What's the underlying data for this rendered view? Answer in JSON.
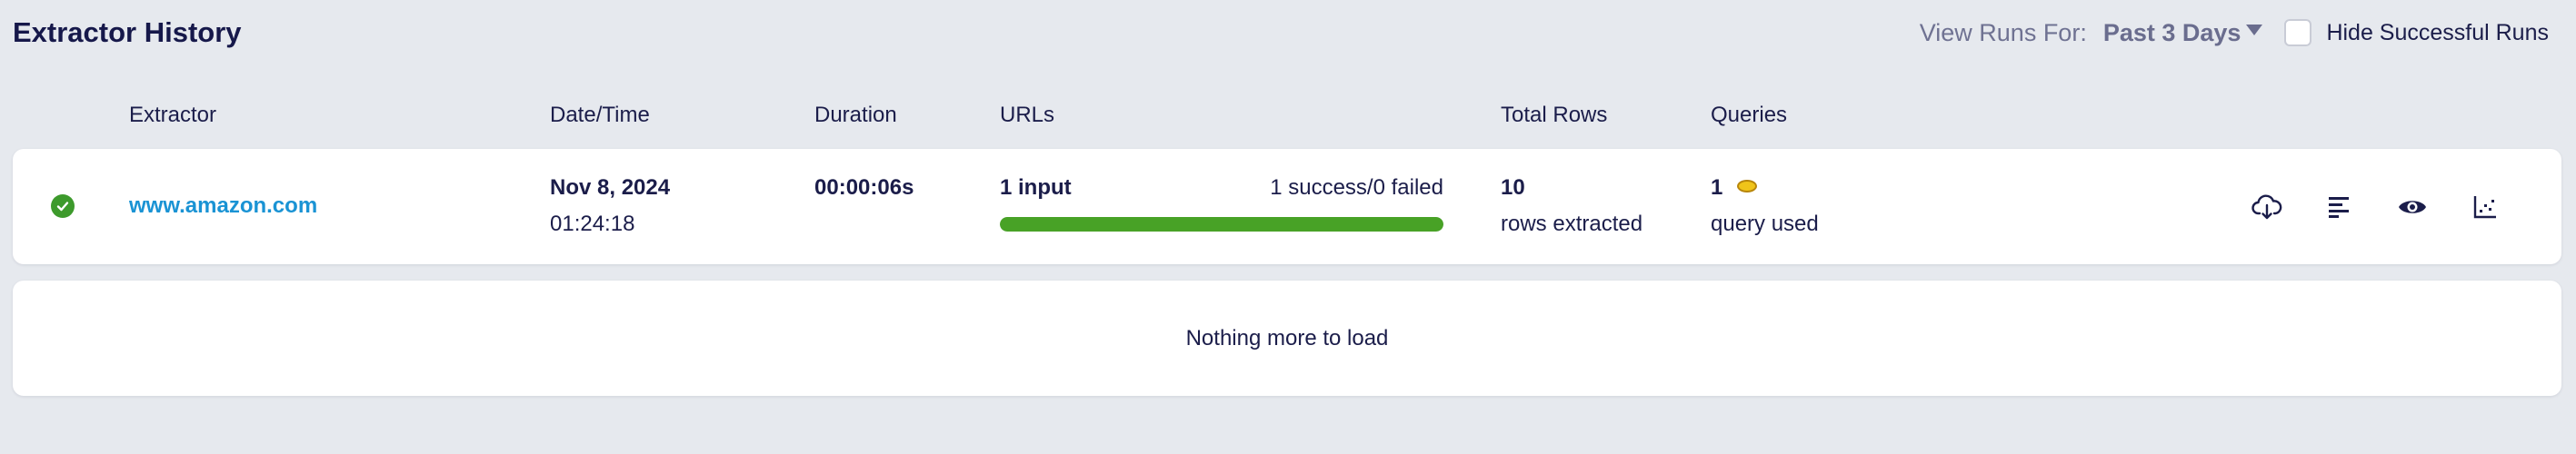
{
  "header": {
    "title": "Extractor History",
    "view_runs_label": "View Runs For:",
    "range_value": "Past 3 Days",
    "hide_successful_label": "Hide Successful Runs",
    "hide_successful_checked": false
  },
  "columns": [
    "Extractor",
    "Date/Time",
    "Duration",
    "URLs",
    "Total Rows",
    "Queries"
  ],
  "runs": [
    {
      "status": "success",
      "status_icon": "check-circle-icon",
      "extractor": "www.amazon.com",
      "date": "Nov 8, 2024",
      "time": "01:24:18",
      "duration": "00:00:06s",
      "urls_input": "1 input",
      "urls_result": "1 success/0 failed",
      "progress": 1.0,
      "rows_count": "10",
      "rows_label": "rows extracted",
      "queries_count": "1",
      "queries_label": "query used",
      "actions": [
        "cloud-download-icon",
        "details-list-icon",
        "view-eye-icon",
        "scatter-chart-icon"
      ]
    }
  ],
  "footer": {
    "nothing_more": "Nothing more to load"
  },
  "colors": {
    "background": "#e6e9ee",
    "accent_link": "#1a93d4",
    "success": "#3d9a2c",
    "progress": "#48a226",
    "muted": "#6f7292"
  }
}
